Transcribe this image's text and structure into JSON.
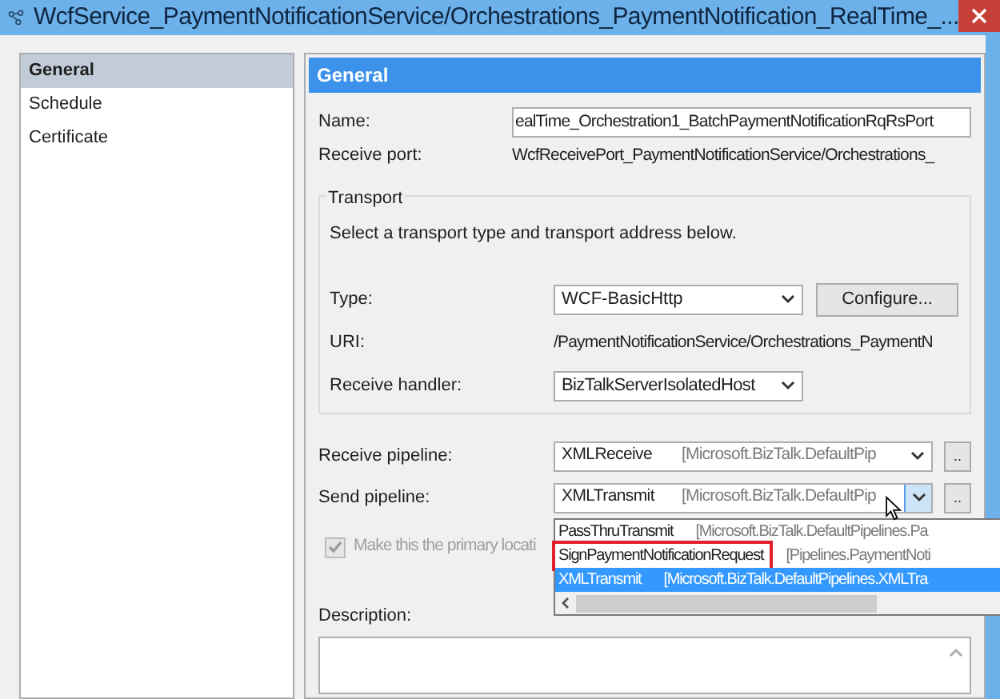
{
  "window": {
    "title": "WcfService_PaymentNotificationService/Orchestrations_PaymentNotification_RealTime_..."
  },
  "nav": [
    {
      "label": "General",
      "selected": true
    },
    {
      "label": "Schedule",
      "selected": false
    },
    {
      "label": "Certificate",
      "selected": false
    }
  ],
  "section_title": "General",
  "fields": [
    {
      "kind": "input",
      "label": "Name:",
      "value": "ealTime_Orchestration1_BatchPaymentNotificationRqRsPort"
    },
    {
      "kind": "text",
      "label": "Receive port:",
      "value": "WcfReceivePort_PaymentNotificationService/Orchestrations_"
    }
  ],
  "transport": {
    "title": "Transport",
    "instruction": "Select a transport type and transport address below.",
    "type": {
      "label": "Type:",
      "value": "WCF-BasicHttp",
      "button": "Configure..."
    },
    "uri": {
      "label": "URI:",
      "value": "/PaymentNotificationService/Orchestrations_PaymentN"
    },
    "handler": {
      "label": "Receive handler:",
      "value": "BizTalkServerIsolatedHost"
    }
  },
  "pipelines": [
    {
      "label": "Receive pipeline:",
      "name": "XMLReceive",
      "assembly": "[Microsoft.BizTalk.DefaultPip",
      "button": "..",
      "open": false
    },
    {
      "label": "Send pipeline:",
      "name": "XMLTransmit",
      "assembly": "[Microsoft.BizTalk.DefaultPip",
      "button": "..",
      "open": true
    }
  ],
  "dropdown_options": [
    {
      "name": "PassThruTransmit",
      "assembly": "[Microsoft.BizTalk.DefaultPipelines.Pa",
      "selected": false,
      "highlighted": false
    },
    {
      "name": "SignPaymentNotificationRequest",
      "assembly": "[Pipelines.PaymentNoti",
      "selected": false,
      "highlighted": true
    },
    {
      "name": "XMLTransmit",
      "assembly": "[Microsoft.BizTalk.DefaultPipelines.XMLTra",
      "selected": true,
      "highlighted": false
    }
  ],
  "primary": {
    "label": "Make this the primary locati",
    "checked": true,
    "disabled": true
  },
  "description": {
    "label": "Description:"
  }
}
